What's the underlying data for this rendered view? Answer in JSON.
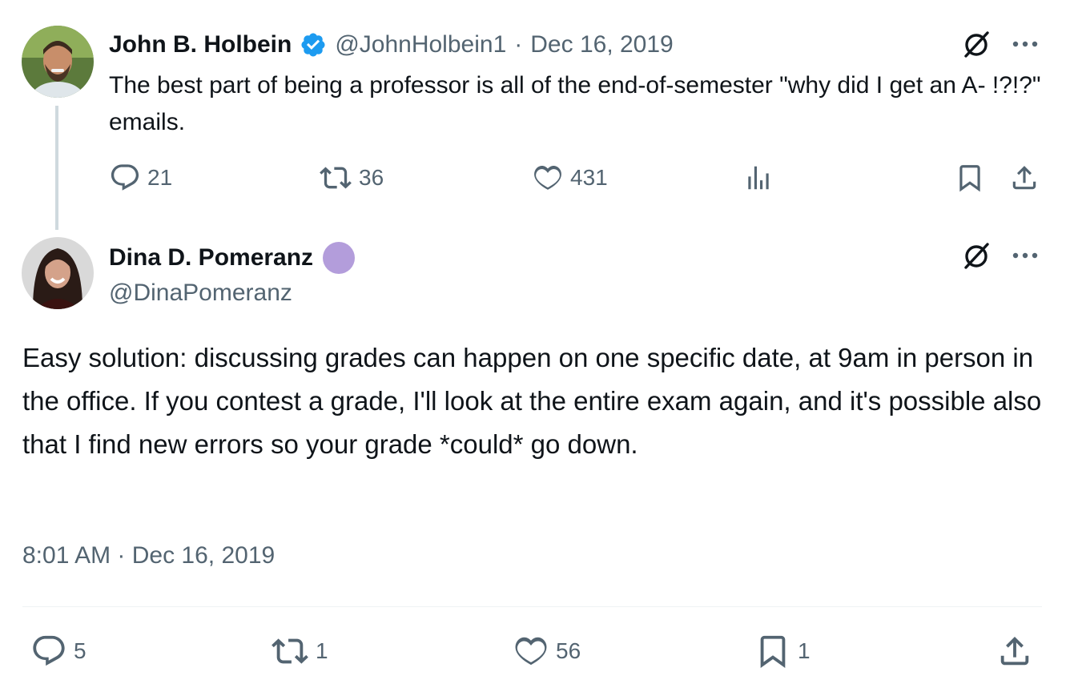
{
  "parent_tweet": {
    "author_name": "John B. Holbein",
    "author_handle": "@JohnHolbein1",
    "date": "Dec 16, 2019",
    "separator": "·",
    "text": "The best part of being a professor is all of the end-of-semester \"why did I get an A- !?!?\" emails.",
    "verified_icon": "verified-badge-icon",
    "actions": {
      "reply_count": "21",
      "retweet_count": "36",
      "like_count": "431",
      "views_icon": "views-chart-icon",
      "bookmark_icon": "bookmark-icon",
      "share_icon": "share-icon"
    }
  },
  "main_tweet": {
    "author_name": "Dina D. Pomeranz",
    "author_handle": "@DinaPomeranz",
    "badge_color": "#b39ddb",
    "text": "Easy solution: discussing grades can happen on one specific date, at 9am in person in the office. If you contest a grade, I'll look at the entire exam again, and it's possible also that I find new errors so your grade *could* go down.",
    "timestamp": "8:01 AM · Dec 16, 2019",
    "actions": {
      "reply_count": "5",
      "retweet_count": "1",
      "like_count": "56",
      "bookmark_count": "1",
      "share_icon": "share-icon"
    }
  },
  "colors": {
    "text": "#0f1419",
    "muted": "#536471",
    "verified": "#1d9bf0",
    "thread_line": "#cfd9de",
    "divider": "#eff3f4"
  }
}
